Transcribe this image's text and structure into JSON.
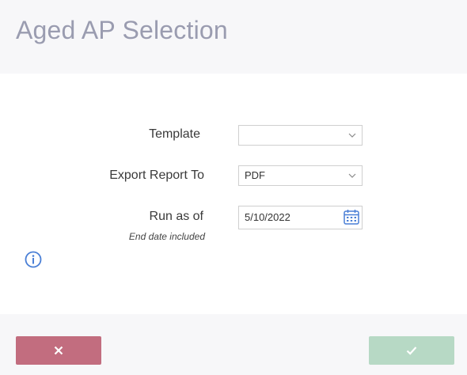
{
  "header": {
    "title": "Aged AP Selection"
  },
  "form": {
    "template": {
      "label": "Template",
      "value": ""
    },
    "export_report_to": {
      "label": "Export Report To",
      "value": "PDF"
    },
    "run_as_of": {
      "label": "Run as of",
      "value": "5/10/2022",
      "note": "End date included"
    }
  },
  "icons": {
    "dropdown": "chevron-down-icon",
    "date_picker": "calendar-icon",
    "info": "info-icon",
    "cancel": "close-icon",
    "confirm": "check-icon"
  },
  "colors": {
    "title": "#9a9cb0",
    "header_bg": "#f7f7f9",
    "cancel_bg": "#c26d7f",
    "confirm_bg": "#b7d9c5",
    "accent_blue": "#4a7fd6"
  }
}
